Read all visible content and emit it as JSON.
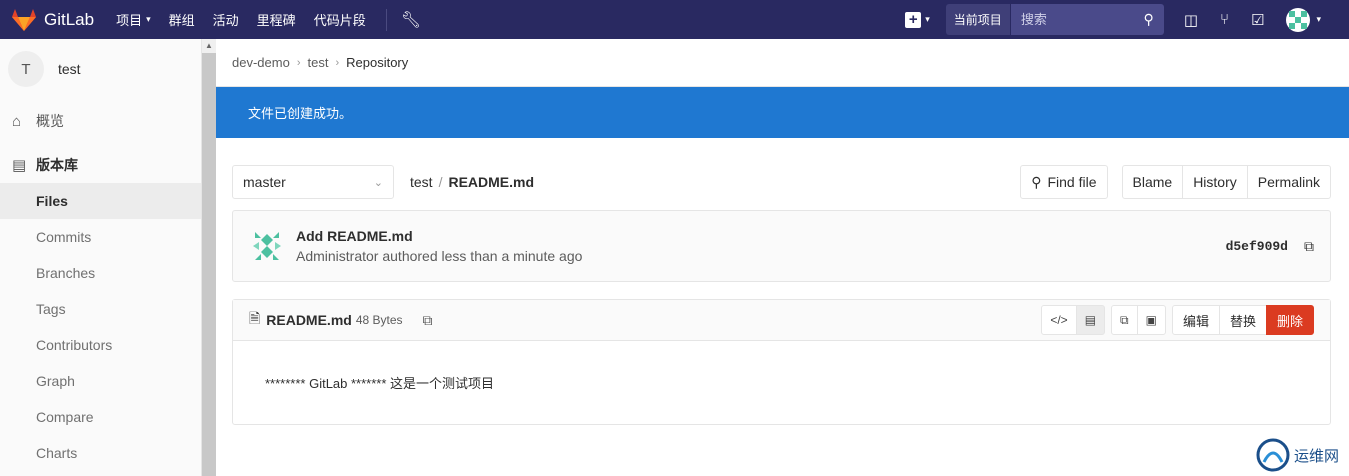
{
  "navbar": {
    "brand": "GitLab",
    "items": [
      "项目",
      "群组",
      "活动",
      "里程碑",
      "代码片段"
    ],
    "search_scope": "当前项目",
    "search_placeholder": "搜索",
    "colors": {
      "background": "#292961"
    }
  },
  "sidebar": {
    "project_initial": "T",
    "project_name": "test",
    "overview": "概览",
    "repository": "版本库",
    "sub_items": [
      "Files",
      "Commits",
      "Branches",
      "Tags",
      "Contributors",
      "Graph",
      "Compare",
      "Charts"
    ]
  },
  "breadcrumb": [
    "dev-demo",
    "test",
    "Repository"
  ],
  "flash": {
    "message": "文件已创建成功。",
    "color": "#1f78d1"
  },
  "file_bar": {
    "branch": "master",
    "path_dir": "test",
    "path_sep": "/",
    "file": "README.md",
    "find_file": "Find file",
    "actions": [
      "Blame",
      "History",
      "Permalink"
    ]
  },
  "commit": {
    "title": "Add README.md",
    "author": "Administrator",
    "authored_text": "authored less than a minute ago",
    "sha": "d5ef909d"
  },
  "file_viewer": {
    "name": "README.md",
    "size": "48 Bytes",
    "edit": "编辑",
    "replace": "替换",
    "delete": "删除",
    "delete_color": "#db3b21",
    "content": "******** GitLab ******* 这是一个测试项目"
  },
  "watermark": {
    "text": "运维网"
  }
}
